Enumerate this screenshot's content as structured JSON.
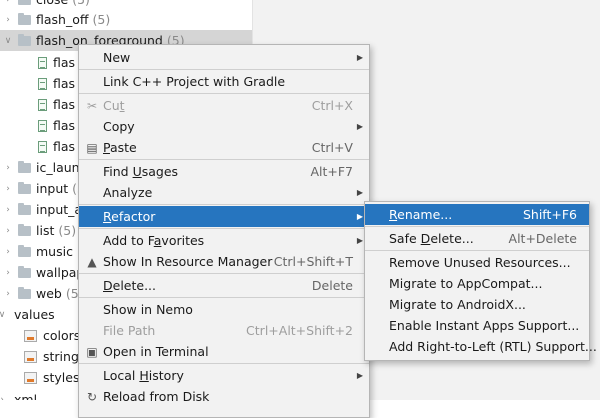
{
  "tree": {
    "rows": [
      {
        "label": "close",
        "count": "(5)",
        "kind": "folder",
        "expanded": false,
        "indent": 0
      },
      {
        "label": "flash_off",
        "count": "(5)",
        "kind": "folder",
        "expanded": false,
        "indent": 0
      },
      {
        "label": "flash_on_foreground",
        "count": "(5)",
        "kind": "folder",
        "expanded": true,
        "indent": 0,
        "selected": true
      },
      {
        "label": "flas",
        "count": "",
        "kind": "file",
        "indent": 1
      },
      {
        "label": "flas",
        "count": "",
        "kind": "file",
        "indent": 1
      },
      {
        "label": "flas",
        "count": "",
        "kind": "file",
        "indent": 1
      },
      {
        "label": "flas",
        "count": "",
        "kind": "file",
        "indent": 1
      },
      {
        "label": "flas",
        "count": "",
        "kind": "file",
        "indent": 1
      },
      {
        "label": "ic_laun",
        "count": "",
        "kind": "folder",
        "expanded": false,
        "indent": 0
      },
      {
        "label": "input",
        "count": "(5",
        "kind": "folder",
        "expanded": false,
        "indent": 0
      },
      {
        "label": "input_a",
        "count": "",
        "kind": "folder",
        "expanded": false,
        "indent": 0
      },
      {
        "label": "list",
        "count": "(5)",
        "kind": "folder",
        "expanded": false,
        "indent": 0
      },
      {
        "label": "music",
        "count": "(",
        "kind": "folder",
        "expanded": false,
        "indent": 0
      },
      {
        "label": "wallpap",
        "count": "",
        "kind": "folder",
        "expanded": false,
        "indent": 0
      },
      {
        "label": "web",
        "count": "(5)",
        "kind": "folder",
        "expanded": false,
        "indent": 0
      },
      {
        "label": "values",
        "count": "",
        "kind": "folder",
        "expanded": true,
        "indent": -1
      },
      {
        "label": "colors.x",
        "count": "",
        "kind": "xml",
        "indent": 1
      },
      {
        "label": "strings",
        "count": "",
        "kind": "xml",
        "indent": 1
      },
      {
        "label": "styles.x",
        "count": "",
        "kind": "xml",
        "indent": 1
      },
      {
        "label": "xml",
        "count": "",
        "kind": "folder",
        "expanded": false,
        "indent": -1
      }
    ]
  },
  "context_menu": {
    "items": [
      {
        "label": "New",
        "mnemonic": "",
        "shortcut": "",
        "submenu": true,
        "icon": "",
        "disabled": false,
        "sep_after": true
      },
      {
        "label": "Link C++ Project with Gradle",
        "mnemonic": "",
        "shortcut": "",
        "submenu": false,
        "icon": "",
        "disabled": false,
        "sep_after": true
      },
      {
        "label": "Cut",
        "mnemonic": "t",
        "shortcut": "Ctrl+X",
        "submenu": false,
        "icon": "scissors-icon",
        "disabled": true,
        "sep_after": false
      },
      {
        "label": "Copy",
        "mnemonic": "",
        "shortcut": "",
        "submenu": true,
        "icon": "",
        "disabled": false,
        "sep_after": false
      },
      {
        "label": "Paste",
        "mnemonic": "P",
        "shortcut": "Ctrl+V",
        "submenu": false,
        "icon": "clipboard-icon",
        "disabled": false,
        "sep_after": true
      },
      {
        "label": "Find Usages",
        "mnemonic": "U",
        "shortcut": "Alt+F7",
        "submenu": false,
        "icon": "",
        "disabled": false,
        "sep_after": false
      },
      {
        "label": "Analyze",
        "mnemonic": "",
        "shortcut": "",
        "submenu": true,
        "icon": "",
        "disabled": false,
        "sep_after": true
      },
      {
        "label": "Refactor",
        "mnemonic": "R",
        "shortcut": "",
        "submenu": true,
        "icon": "",
        "disabled": false,
        "highlight": true,
        "sep_after": true
      },
      {
        "label": "Add to Favorites",
        "mnemonic": "a",
        "shortcut": "",
        "submenu": true,
        "icon": "",
        "disabled": false,
        "sep_after": false
      },
      {
        "label": "Show In Resource Manager",
        "mnemonic": "",
        "shortcut": "Ctrl+Shift+T",
        "submenu": false,
        "icon": "resource-manager-icon",
        "disabled": false,
        "sep_after": true
      },
      {
        "label": "Delete...",
        "mnemonic": "D",
        "shortcut": "Delete",
        "submenu": false,
        "icon": "",
        "disabled": false,
        "sep_after": true
      },
      {
        "label": "Show in Nemo",
        "mnemonic": "",
        "shortcut": "",
        "submenu": false,
        "icon": "",
        "disabled": false,
        "sep_after": false
      },
      {
        "label": "File Path",
        "mnemonic": "",
        "shortcut": "Ctrl+Alt+Shift+2",
        "submenu": false,
        "icon": "",
        "disabled": true,
        "sep_after": false
      },
      {
        "label": "Open in Terminal",
        "mnemonic": "",
        "shortcut": "",
        "submenu": false,
        "icon": "terminal-icon",
        "disabled": false,
        "sep_after": true
      },
      {
        "label": "Local History",
        "mnemonic": "H",
        "shortcut": "",
        "submenu": true,
        "icon": "",
        "disabled": false,
        "sep_after": false
      },
      {
        "label": "Reload from Disk",
        "mnemonic": "",
        "shortcut": "",
        "submenu": false,
        "icon": "reload-icon",
        "disabled": false,
        "sep_after": false
      }
    ]
  },
  "refactor_submenu": {
    "items": [
      {
        "label": "Rename...",
        "mnemonic": "R",
        "shortcut": "Shift+F6",
        "highlight": true,
        "sep_after": true
      },
      {
        "label": "Safe Delete...",
        "mnemonic": "D",
        "shortcut": "Alt+Delete",
        "highlight": false,
        "sep_after": true
      },
      {
        "label": "Remove Unused Resources...",
        "mnemonic": "",
        "shortcut": "",
        "highlight": false,
        "sep_after": false
      },
      {
        "label": "Migrate to AppCompat...",
        "mnemonic": "",
        "shortcut": "",
        "highlight": false,
        "sep_after": false
      },
      {
        "label": "Migrate to AndroidX...",
        "mnemonic": "",
        "shortcut": "",
        "highlight": false,
        "sep_after": false
      },
      {
        "label": "Enable Instant Apps Support...",
        "mnemonic": "",
        "shortcut": "",
        "highlight": false,
        "sep_after": false
      },
      {
        "label": "Add Right-to-Left (RTL) Support...",
        "mnemonic": "",
        "shortcut": "",
        "highlight": false,
        "sep_after": false
      }
    ]
  },
  "colors": {
    "highlight": "#2675bf",
    "menu_bg": "#f2f2f2",
    "selected_row": "#d5d5d5"
  }
}
